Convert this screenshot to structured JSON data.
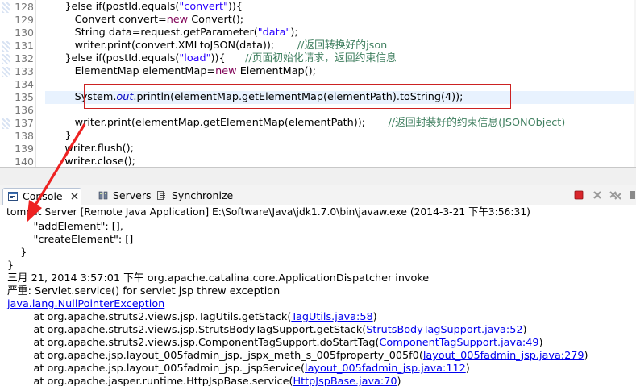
{
  "editor": {
    "lines": [
      {
        "no": "128",
        "segments": [
          {
            "t": "      }else if(postId.equals(",
            "c": "plain"
          },
          {
            "t": "\"convert\"",
            "c": "str"
          },
          {
            "t": ")){",
            "c": "plain"
          }
        ]
      },
      {
        "no": "129",
        "segments": [
          {
            "t": "         Convert convert=",
            "c": "plain"
          },
          {
            "t": "new",
            "c": "kw"
          },
          {
            "t": " Convert();",
            "c": "plain"
          }
        ]
      },
      {
        "no": "130",
        "segments": [
          {
            "t": "         String data=request.getParameter(",
            "c": "plain"
          },
          {
            "t": "\"data\"",
            "c": "str"
          },
          {
            "t": ");",
            "c": "plain"
          }
        ]
      },
      {
        "no": "131",
        "segments": [
          {
            "t": "         writer.print(convert.XMLtoJSON(data));       ",
            "c": "plain"
          },
          {
            "t": "//返回转换好的json",
            "c": "cm"
          }
        ]
      },
      {
        "no": "132",
        "segments": [
          {
            "t": "      }else if(postId.equals(",
            "c": "plain"
          },
          {
            "t": "\"load\"",
            "c": "str"
          },
          {
            "t": ")){      ",
            "c": "plain"
          },
          {
            "t": "//页面初始化请求，返回约束信息",
            "c": "cm"
          }
        ]
      },
      {
        "no": "133",
        "segments": [
          {
            "t": "         ElementMap elementMap=",
            "c": "plain"
          },
          {
            "t": "new",
            "c": "kw"
          },
          {
            "t": " ElementMap();",
            "c": "plain"
          }
        ]
      },
      {
        "no": "134",
        "segments": []
      },
      {
        "no": "135",
        "segments": [
          {
            "t": "         System.",
            "c": "plain"
          },
          {
            "t": "out",
            "c": "fld"
          },
          {
            "t": ".println(elementMap.getElementMap(elementPath).toString(4));",
            "c": "plain"
          }
        ]
      },
      {
        "no": "136",
        "segments": []
      },
      {
        "no": "137",
        "segments": [
          {
            "t": "         writer.print(elementMap.getElementMap(elementPath));       ",
            "c": "plain"
          },
          {
            "t": "//返回封装好的约束信息(JSONObject)",
            "c": "cm"
          }
        ]
      },
      {
        "no": "138",
        "segments": [
          {
            "t": "      }",
            "c": "plain"
          }
        ]
      },
      {
        "no": "139",
        "segments": [
          {
            "t": "      writer.flush();",
            "c": "plain"
          }
        ]
      },
      {
        "no": "140",
        "segments": [
          {
            "t": "      writer.close();",
            "c": "plain"
          }
        ]
      }
    ]
  },
  "tabs": {
    "console": "Console",
    "servers": "Servers",
    "synchronize": "Synchronize"
  },
  "status": "tomcat Server [Remote Java Application] E:\\Software\\Java\\jdk1.7.0\\bin\\javaw.exe (2014-3-21 下午3:56:31)",
  "console": {
    "lines": [
      {
        "segments": [
          {
            "t": "        \"addElement\": [],",
            "c": "plain"
          }
        ]
      },
      {
        "segments": [
          {
            "t": "        \"createElement\": []",
            "c": "plain"
          }
        ]
      },
      {
        "segments": [
          {
            "t": "    }",
            "c": "plain"
          }
        ]
      },
      {
        "segments": [
          {
            "t": "}",
            "c": "plain"
          }
        ]
      },
      {
        "segments": [
          {
            "t": "三月 21, 2014 3:57:01 下午 org.apache.catalina.core.ApplicationDispatcher invoke",
            "c": "plain"
          }
        ]
      },
      {
        "segments": [
          {
            "t": "严重: Servlet.service() for servlet jsp threw exception",
            "c": "plain"
          }
        ]
      },
      {
        "segments": [
          {
            "t": "java.lang.NullPointerException",
            "c": "link"
          }
        ]
      },
      {
        "segments": [
          {
            "t": "        at org.apache.struts2.views.jsp.TagUtils.getStack(",
            "c": "plain"
          },
          {
            "t": "TagUtils.java:58",
            "c": "link"
          },
          {
            "t": ")",
            "c": "plain"
          }
        ]
      },
      {
        "segments": [
          {
            "t": "        at org.apache.struts2.views.jsp.StrutsBodyTagSupport.getStack(",
            "c": "plain"
          },
          {
            "t": "StrutsBodyTagSupport.java:52",
            "c": "link"
          },
          {
            "t": ")",
            "c": "plain"
          }
        ]
      },
      {
        "segments": [
          {
            "t": "        at org.apache.struts2.views.jsp.ComponentTagSupport.doStartTag(",
            "c": "plain"
          },
          {
            "t": "ComponentTagSupport.java:49",
            "c": "link"
          },
          {
            "t": ")",
            "c": "plain"
          }
        ]
      },
      {
        "segments": [
          {
            "t": "        at org.apache.jsp.layout_005fadmin_jsp._jspx_meth_s_005fproperty_005f0(",
            "c": "plain"
          },
          {
            "t": "layout_005fadmin_jsp.java:279",
            "c": "link"
          },
          {
            "t": ")",
            "c": "plain"
          }
        ]
      },
      {
        "segments": [
          {
            "t": "        at org.apache.jsp.layout_005fadmin_jsp._jspService(",
            "c": "plain"
          },
          {
            "t": "layout_005fadmin_jsp.java:112",
            "c": "link"
          },
          {
            "t": ")",
            "c": "plain"
          }
        ]
      },
      {
        "segments": [
          {
            "t": "        at org.apache.jasper.runtime.HttpJspBase.service(",
            "c": "plain"
          },
          {
            "t": "HttpJspBase.java:70",
            "c": "link"
          },
          {
            "t": ")",
            "c": "plain"
          }
        ]
      }
    ]
  },
  "colors": {
    "keyword": "#7f0055",
    "string": "#2a00ff",
    "comment": "#3f7f5f",
    "field": "#0000c0",
    "link": "#0000ee",
    "annotation": "#cc2222"
  },
  "icons": {
    "console_tab": "console-icon",
    "console_close": "close-icon",
    "servers_tab": "servers-icon",
    "sync_tab": "synchronize-icon",
    "terminate": "terminate-icon",
    "remove": "remove-launch-icon",
    "remove_all": "remove-all-icon",
    "more": "menu-icon"
  }
}
